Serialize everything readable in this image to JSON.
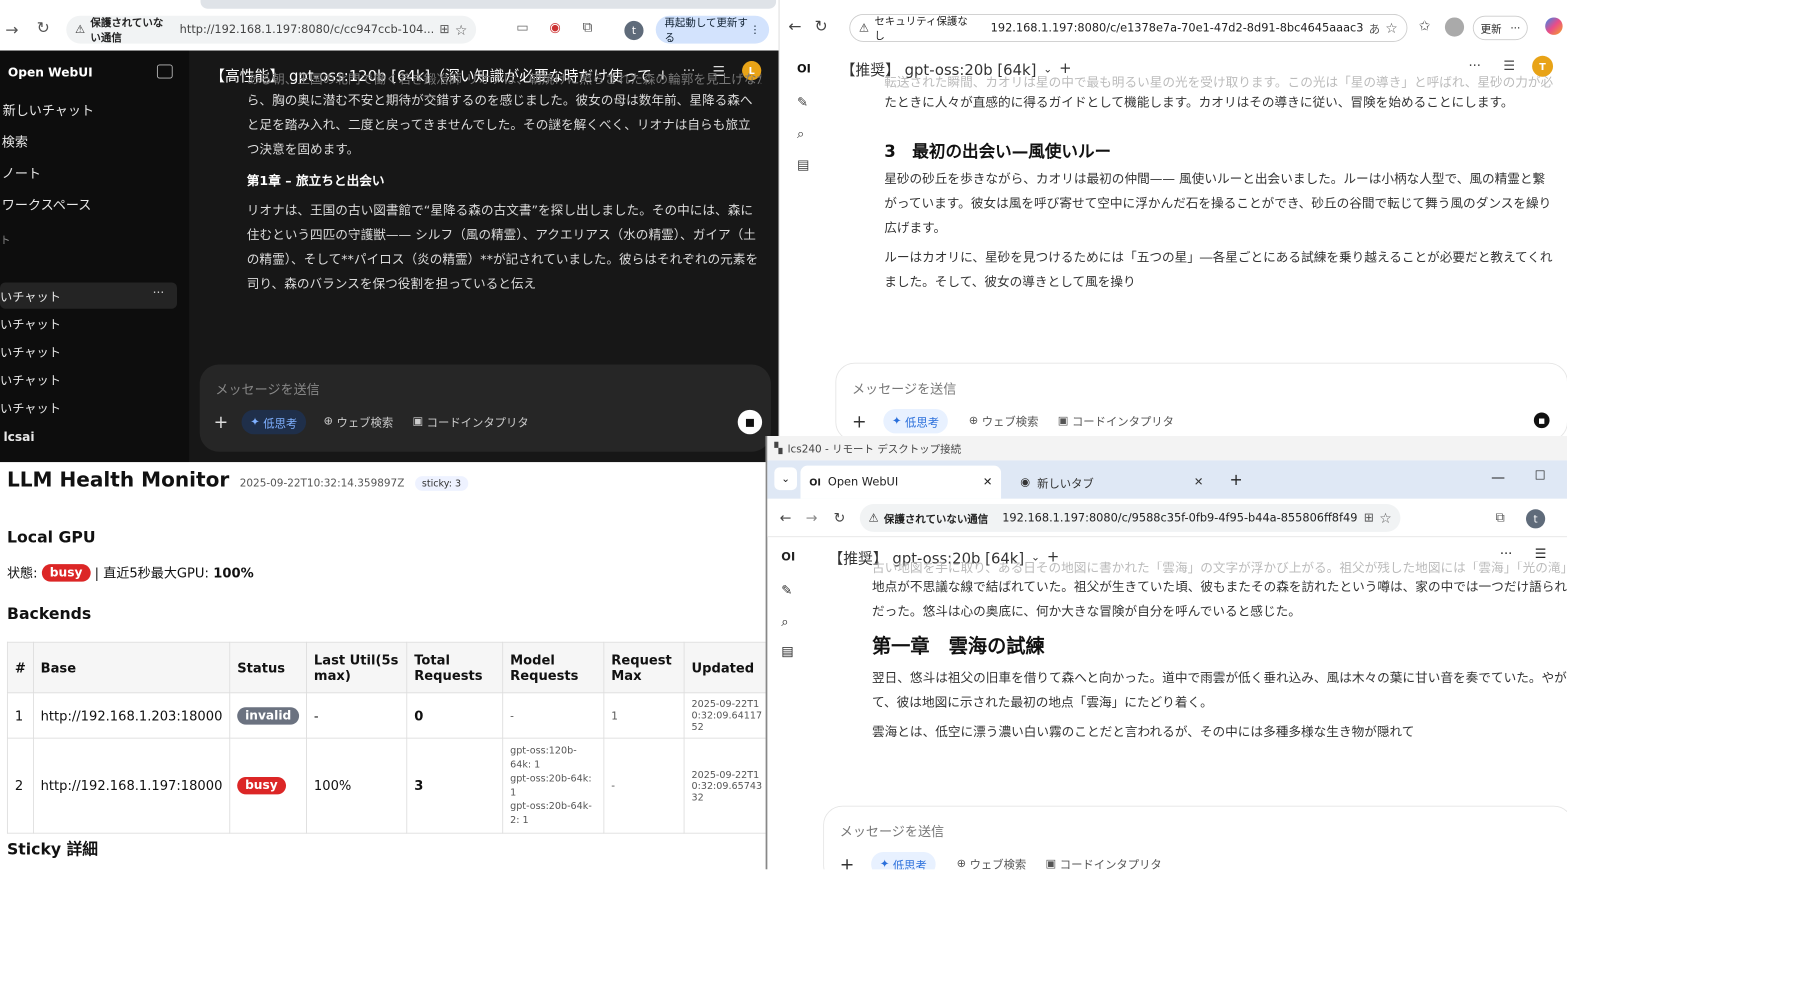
{
  "w1": {
    "url": "http://192.168.1.197:8080/c/cc947ccb-104...",
    "security": "保護されていない通信",
    "restart": "再起動して更新する",
    "avatar_t": "t",
    "app_name": "Open WebUI",
    "new_chat": "新しいチャット",
    "search": "検索",
    "notes": "ノート",
    "workspace": "ワークスペース",
    "section_glyph": "ト",
    "chats": [
      "いチャット",
      "いチャット",
      "いチャット",
      "いチャット",
      "いチャット"
    ],
    "more": "···",
    "user": "lcsai",
    "model": "【高性能】 gpt-oss:120b [64k]（深い知識が必要な時だけ使って",
    "model_plus": "+",
    "avatar": "L",
    "para1_faded": "ある朝、王国の北門で働く若き鍛冶師 リオナは、朝焼けに照らされた森の輪郭を見上げなが",
    "para1": "ら、胸の奥に潜む不安と期待が交錯するのを感じました。彼女の母は数年前、星降る森へと足を踏み入れ、二度と戻ってきませんでした。その謎を解くべく、リオナは自らも旅立つ決意を固めます。",
    "heading": "第1章 – 旅立ちと出会い",
    "para2": "リオナは、王国の古い図書館で“星降る森の古文書”を探し出しました。その中には、森に住むという四匹の守護獣—— シルフ（風の精霊）、アクエリアス（水の精霊）、ガイア（土の精霊）、そして**パイロス（炎の精霊）**が記されていました。彼らはそれぞれの元素を司り、森のバランスを保つ役割を担っていると伝え",
    "input_placeholder": "メッセージを送信",
    "think": "低思考",
    "web": "ウェブ検索",
    "code": "コードインタプリタ"
  },
  "w2": {
    "security": "セキュリティ保護なし",
    "url": "192.168.1.197:8080/c/e1378e7a-70e1-47d2-8d91-8bc4645aaac3",
    "aa": "あ",
    "update": "更新",
    "logo": "OI",
    "model": "【推奨】 gpt-oss:20b [64k]",
    "avatar": "T",
    "faded": "転送された瞬間、カオリは星の中で最も明るい星の光を受け取ります。この光は「星の導き」と呼ばれ、星砂の力が必",
    "line_a": "たときに人々が直感的に得るガイドとして機能します。カオリはその導きに従い、冒険を始めることにします。",
    "heading": "3　最初の出会い—風使いルー",
    "para1": "星砂の砂丘を歩きながら、カオリは最初の仲間—— 風使いルーと出会いました。ルーは小柄な人型で、風の精霊と繋がっています。彼女は風を呼び寄せて空中に浮かんだ石を操ることができ、砂丘の谷間で転じて舞う風のダンスを繰り広げます。",
    "para2": "ルーはカオリに、星砂を見つけるためには「五つの星」―各星ごとにある試練を乗り越えることが必要だと教えてくれました。そして、彼女の導きとして風を操り",
    "input_placeholder": "メッセージを送信",
    "think": "低思考",
    "web": "ウェブ検索",
    "code": "コードインタプリタ"
  },
  "w3": {
    "title": "LLM Health Monitor",
    "timestamp": "2025-09-22T10:32:14.359897Z",
    "sticky": "sticky: 3",
    "local_gpu": "Local GPU",
    "status_label": "状態:",
    "status_value": "busy",
    "gpu_text": "| 直近5秒最大GPU:",
    "gpu_value": "100%",
    "backends": "Backends",
    "headers": [
      "#",
      "Base",
      "Status",
      "Last Util(5s max)",
      "Total Requests",
      "Model Requests",
      "Request Max",
      "Updated"
    ],
    "rows": [
      {
        "n": "1",
        "base": "http://192.168.1.203:18000",
        "status": "invalid",
        "util": "-",
        "total": "0",
        "model": "-",
        "max": "1",
        "updated": "2025-09-22T10:32:09.6411752"
      },
      {
        "n": "2",
        "base": "http://192.168.1.197:18000",
        "status": "busy",
        "util": "100%",
        "total": "3",
        "model": "gpt-oss:120b-64k: 1\ngpt-oss:20b-64k: 1\ngpt-oss:20b-64k-2: 1",
        "max": "-",
        "updated": "2025-09-22T10:32:09.6574332"
      }
    ],
    "sticky_detail": "Sticky 詳細"
  },
  "w4": {
    "title": "lcs240 - リモート デスクトップ接続",
    "tab1": "Open WebUI",
    "tab2": "新しいタブ",
    "security": "保護されていない通信",
    "url": "192.168.1.197:8080/c/9588c35f-0fb9-4f95-b44a-855806ff8f49",
    "avatar_t": "t",
    "logo": "OI",
    "model": "【推奨】 gpt-oss:20b [64k]",
    "faded": "古い地図を手に取り、ある日その地図に書かれた「雲海」の文字が浮かび上がる。祖父が残した地図には「雲海」「光の滝」「星降る森」といった",
    "line_a": "地点が不思議な線で結ばれていた。祖父が生きていた頃、彼もまたその森を訪れたという噂は、家の中では一つだけ語られる逸話",
    "line_b": "だった。悠斗は心の奥底に、何か大きな冒険が自分を呼んでいると感じた。",
    "heading": "第一章　雲海の試練",
    "para1": "翌日、悠斗は祖父の旧車を借りて森へと向かった。道中で雨雲が低く垂れ込み、風は木々の葉に甘い音を奏でていた。やがて、彼は地図に示された最初の地点「雲海」にたどり着く。",
    "para2": "雲海とは、低空に漂う濃い白い霧のことだと言われるが、その中には多種多様な生き物が隠れて",
    "input_placeholder": "メッセージを送信",
    "think": "低思考",
    "web": "ウェブ検索",
    "code": "コードインタプリタ"
  }
}
